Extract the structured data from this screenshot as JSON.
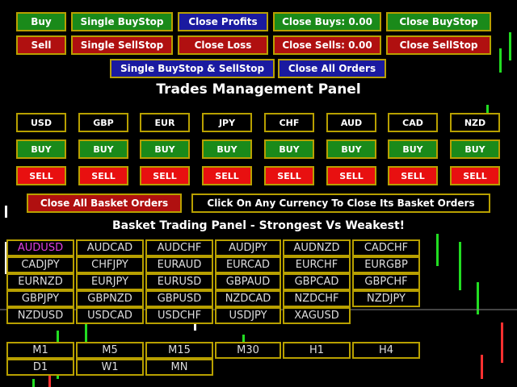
{
  "colors": {
    "green": "#1a8a1a",
    "red": "#b01010",
    "blue": "#1a1aa0",
    "border": "#b8a000",
    "selected_pair": "#e040e0"
  },
  "top_buttons": {
    "row1": [
      "Buy",
      "Single BuyStop",
      "Close Profits",
      "Close Buys: 0.00",
      "Close BuyStop"
    ],
    "row2": [
      "Sell",
      "Single SellStop",
      "Close Loss",
      "Close Sells: 0.00",
      "Close SellStop"
    ],
    "row3": [
      "Single BuyStop & SellStop",
      "Close All Orders"
    ]
  },
  "trades_title": "Trades Management Panel",
  "currencies": [
    "USD",
    "GBP",
    "EUR",
    "JPY",
    "CHF",
    "AUD",
    "CAD",
    "NZD"
  ],
  "buy_label": "BUY",
  "sell_label": "SELL",
  "close_all_basket": "Close All Basket Orders",
  "click_info": "Click On Any Currency To Close Its Basket Orders",
  "basket_title": "Basket Trading Panel - Strongest Vs Weakest!",
  "pairs": [
    [
      "AUDUSD",
      "AUDCAD",
      "AUDCHF",
      "AUDJPY",
      "AUDNZD",
      "CADCHF"
    ],
    [
      "CADJPY",
      "CHFJPY",
      "EURAUD",
      "EURCAD",
      "EURCHF",
      "EURGBP"
    ],
    [
      "EURNZD",
      "EURJPY",
      "EURUSD",
      "GBPAUD",
      "GBPCAD",
      "GBPCHF"
    ],
    [
      "GBPJPY",
      "GBPNZD",
      "GBPUSD",
      "NZDCAD",
      "NZDCHF",
      "NZDJPY"
    ],
    [
      "NZDUSD",
      "USDCAD",
      "USDCHF",
      "USDJPY",
      "XAGUSD"
    ]
  ],
  "selected_pair": "AUDUSD",
  "timeframes": [
    [
      "M1",
      "M5",
      "M15",
      "M30",
      "H1",
      "H4"
    ],
    [
      "D1",
      "W1",
      "MN"
    ]
  ]
}
